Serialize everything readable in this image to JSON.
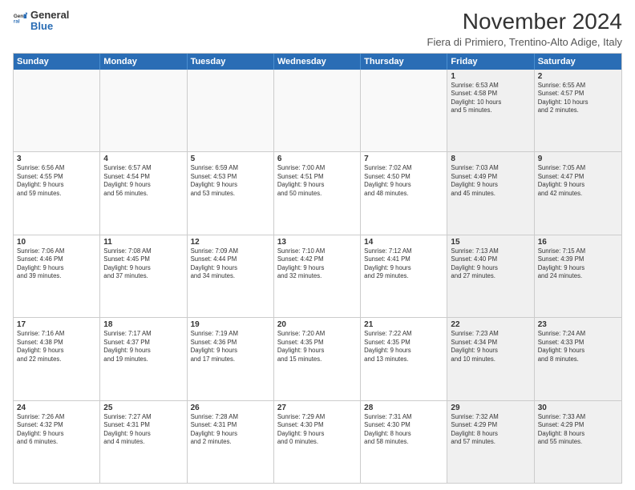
{
  "logo": {
    "line1": "General",
    "line2": "Blue"
  },
  "title": "November 2024",
  "location": "Fiera di Primiero, Trentino-Alto Adige, Italy",
  "header_days": [
    "Sunday",
    "Monday",
    "Tuesday",
    "Wednesday",
    "Thursday",
    "Friday",
    "Saturday"
  ],
  "rows": [
    [
      {
        "day": "",
        "detail": "",
        "empty": true
      },
      {
        "day": "",
        "detail": "",
        "empty": true
      },
      {
        "day": "",
        "detail": "",
        "empty": true
      },
      {
        "day": "",
        "detail": "",
        "empty": true
      },
      {
        "day": "",
        "detail": "",
        "empty": true
      },
      {
        "day": "1",
        "detail": "Sunrise: 6:53 AM\nSunset: 4:58 PM\nDaylight: 10 hours\nand 5 minutes.",
        "shaded": true
      },
      {
        "day": "2",
        "detail": "Sunrise: 6:55 AM\nSunset: 4:57 PM\nDaylight: 10 hours\nand 2 minutes.",
        "shaded": true
      }
    ],
    [
      {
        "day": "3",
        "detail": "Sunrise: 6:56 AM\nSunset: 4:55 PM\nDaylight: 9 hours\nand 59 minutes."
      },
      {
        "day": "4",
        "detail": "Sunrise: 6:57 AM\nSunset: 4:54 PM\nDaylight: 9 hours\nand 56 minutes."
      },
      {
        "day": "5",
        "detail": "Sunrise: 6:59 AM\nSunset: 4:53 PM\nDaylight: 9 hours\nand 53 minutes."
      },
      {
        "day": "6",
        "detail": "Sunrise: 7:00 AM\nSunset: 4:51 PM\nDaylight: 9 hours\nand 50 minutes."
      },
      {
        "day": "7",
        "detail": "Sunrise: 7:02 AM\nSunset: 4:50 PM\nDaylight: 9 hours\nand 48 minutes."
      },
      {
        "day": "8",
        "detail": "Sunrise: 7:03 AM\nSunset: 4:49 PM\nDaylight: 9 hours\nand 45 minutes.",
        "shaded": true
      },
      {
        "day": "9",
        "detail": "Sunrise: 7:05 AM\nSunset: 4:47 PM\nDaylight: 9 hours\nand 42 minutes.",
        "shaded": true
      }
    ],
    [
      {
        "day": "10",
        "detail": "Sunrise: 7:06 AM\nSunset: 4:46 PM\nDaylight: 9 hours\nand 39 minutes."
      },
      {
        "day": "11",
        "detail": "Sunrise: 7:08 AM\nSunset: 4:45 PM\nDaylight: 9 hours\nand 37 minutes."
      },
      {
        "day": "12",
        "detail": "Sunrise: 7:09 AM\nSunset: 4:44 PM\nDaylight: 9 hours\nand 34 minutes."
      },
      {
        "day": "13",
        "detail": "Sunrise: 7:10 AM\nSunset: 4:42 PM\nDaylight: 9 hours\nand 32 minutes."
      },
      {
        "day": "14",
        "detail": "Sunrise: 7:12 AM\nSunset: 4:41 PM\nDaylight: 9 hours\nand 29 minutes."
      },
      {
        "day": "15",
        "detail": "Sunrise: 7:13 AM\nSunset: 4:40 PM\nDaylight: 9 hours\nand 27 minutes.",
        "shaded": true
      },
      {
        "day": "16",
        "detail": "Sunrise: 7:15 AM\nSunset: 4:39 PM\nDaylight: 9 hours\nand 24 minutes.",
        "shaded": true
      }
    ],
    [
      {
        "day": "17",
        "detail": "Sunrise: 7:16 AM\nSunset: 4:38 PM\nDaylight: 9 hours\nand 22 minutes."
      },
      {
        "day": "18",
        "detail": "Sunrise: 7:17 AM\nSunset: 4:37 PM\nDaylight: 9 hours\nand 19 minutes."
      },
      {
        "day": "19",
        "detail": "Sunrise: 7:19 AM\nSunset: 4:36 PM\nDaylight: 9 hours\nand 17 minutes."
      },
      {
        "day": "20",
        "detail": "Sunrise: 7:20 AM\nSunset: 4:35 PM\nDaylight: 9 hours\nand 15 minutes."
      },
      {
        "day": "21",
        "detail": "Sunrise: 7:22 AM\nSunset: 4:35 PM\nDaylight: 9 hours\nand 13 minutes."
      },
      {
        "day": "22",
        "detail": "Sunrise: 7:23 AM\nSunset: 4:34 PM\nDaylight: 9 hours\nand 10 minutes.",
        "shaded": true
      },
      {
        "day": "23",
        "detail": "Sunrise: 7:24 AM\nSunset: 4:33 PM\nDaylight: 9 hours\nand 8 minutes.",
        "shaded": true
      }
    ],
    [
      {
        "day": "24",
        "detail": "Sunrise: 7:26 AM\nSunset: 4:32 PM\nDaylight: 9 hours\nand 6 minutes."
      },
      {
        "day": "25",
        "detail": "Sunrise: 7:27 AM\nSunset: 4:31 PM\nDaylight: 9 hours\nand 4 minutes."
      },
      {
        "day": "26",
        "detail": "Sunrise: 7:28 AM\nSunset: 4:31 PM\nDaylight: 9 hours\nand 2 minutes."
      },
      {
        "day": "27",
        "detail": "Sunrise: 7:29 AM\nSunset: 4:30 PM\nDaylight: 9 hours\nand 0 minutes."
      },
      {
        "day": "28",
        "detail": "Sunrise: 7:31 AM\nSunset: 4:30 PM\nDaylight: 8 hours\nand 58 minutes."
      },
      {
        "day": "29",
        "detail": "Sunrise: 7:32 AM\nSunset: 4:29 PM\nDaylight: 8 hours\nand 57 minutes.",
        "shaded": true
      },
      {
        "day": "30",
        "detail": "Sunrise: 7:33 AM\nSunset: 4:29 PM\nDaylight: 8 hours\nand 55 minutes.",
        "shaded": true
      }
    ]
  ]
}
